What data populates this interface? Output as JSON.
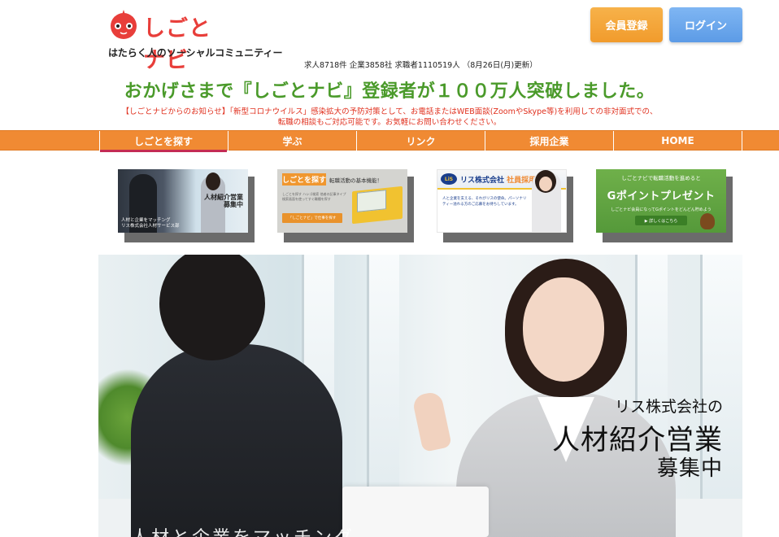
{
  "header": {
    "logo_text": "しごとナビ",
    "tagline": "はたらく人のソーシャルコミュニティー",
    "stats": "求人8718件 企業3858社 求職者1110519人 （8月26日(月)更新）",
    "register_label": "会員登録",
    "login_label": "ログイン"
  },
  "announcement": {
    "headline": "おかげさまで『しごとナビ』登録者が１００万人突破しました。",
    "notice_line1": "【しごとナビからのお知らせ】「新型コロナウイルス」感染拡大の予防対策として、お電話またはWEB面談(ZoomやSkype等)を利用しての非対面式での、",
    "notice_line2": "転職の相談もご対応可能です。お気軽にお問い合わせください。"
  },
  "nav": {
    "items": [
      {
        "label": "しごとを探す",
        "active": true
      },
      {
        "label": "学ぶ"
      },
      {
        "label": "リンク"
      },
      {
        "label": "採用企業"
      },
      {
        "label": "HOME"
      }
    ]
  },
  "banners": {
    "b1": {
      "title": "人材紹介営業\n募集中",
      "caption": "人材と企業をマッチング\nリス株式会社人材サービス部"
    },
    "b2": {
      "tab": "しごとを探す",
      "sub": "転職活動の基本機能！",
      "text": "しごとを探す ハシゴ検索 他者の記事タイプ 検索画面を使ってすぐ職種を探す",
      "cta": "「しごとナビ」で仕事を探す"
    },
    "b3": {
      "mark": "LiS",
      "title_company": "リス株式会社",
      "title_hire": "社員採用",
      "text": "人と企業を支える、それがリスの使命。パーソナリティー溢れる方のご応募をお待ちしています。"
    },
    "b4": {
      "top": "しごとナビで転職活動を進めると",
      "big": "Gポイントプレゼント",
      "sub": "しごとナビ会員になってGポイントをどんどん貯めよう",
      "cta": "▶ 詳しくはこちら"
    }
  },
  "hero": {
    "company": "リス株式会社の",
    "headline": "人材紹介営業",
    "subheadline": "募集中",
    "bottom_text": "人材と企業をマッチング"
  },
  "colors": {
    "brand_red": "#e83e3a",
    "nav_orange": "#f08a33",
    "headline_green": "#4a9a2a",
    "notice_red": "#e0301e",
    "register_orange": "#f19b2c",
    "login_blue": "#5c9be6"
  }
}
